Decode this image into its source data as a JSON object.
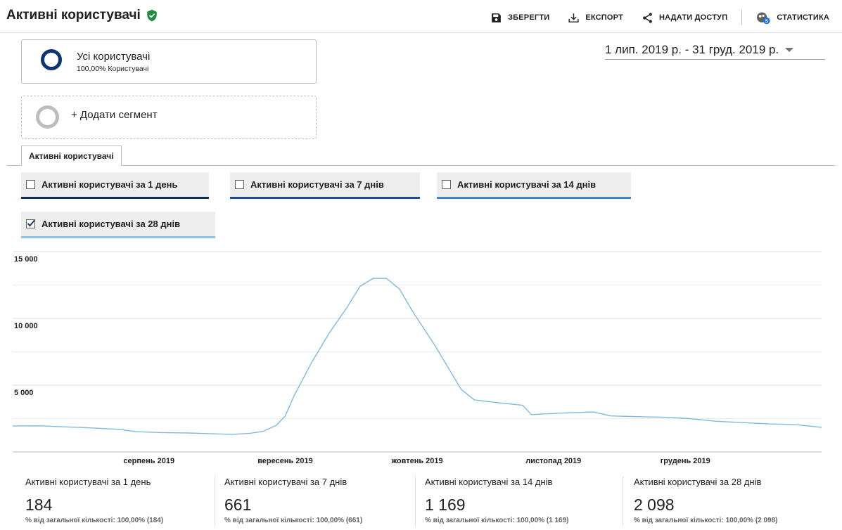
{
  "header": {
    "title": "Активні користувачі",
    "verified_icon": "shield-check-icon",
    "toolbar": [
      {
        "label": "ЗБЕРЕГТИ",
        "icon": "save-icon"
      },
      {
        "label": "ЕКСПОРТ",
        "icon": "export-icon"
      },
      {
        "label": "НАДАТИ ДОСТУП",
        "icon": "share-icon"
      },
      {
        "label": "СТАТИСТИКА",
        "icon": "insights-icon",
        "badge": "5"
      }
    ]
  },
  "segment": {
    "name": "Усі користувачі",
    "sub": "100,00% Користувачі",
    "ring_color": "#0c3372"
  },
  "add_segment": {
    "label": "+ Додати сегмент"
  },
  "date_range": {
    "label": "1 лип. 2019 р. - 31 груд. 2019 р."
  },
  "tab": {
    "label": "Активні користувачі"
  },
  "metrics": [
    {
      "label": "Активні користувачі за 1 день",
      "checked": false,
      "color": "#0c2c5c"
    },
    {
      "label": "Активні користувачі за 7 днів",
      "checked": false,
      "color": "#1a4b8c"
    },
    {
      "label": "Активні користувачі за 14 днів",
      "checked": false,
      "color": "#3d86c6"
    },
    {
      "label": "Активні користувачі за 28 днів",
      "checked": true,
      "color": "#8fc3ea"
    }
  ],
  "chart_data": {
    "type": "line",
    "yticks": [
      "15 000",
      "10 000",
      "5 000"
    ],
    "ytick_values": [
      15000,
      10000,
      5000
    ],
    "ylim": [
      0,
      15000
    ],
    "xlabels": [
      "серпень 2019",
      "вересень 2019",
      "жовтень 2019",
      "листопад 2019",
      "грудень 2019"
    ],
    "xlabel_days": [
      31,
      62,
      92,
      123,
      153
    ],
    "xdomain": [
      0,
      184
    ],
    "series": [
      {
        "color": "#7fb9e0",
        "points": [
          [
            0,
            1950
          ],
          [
            6,
            1960
          ],
          [
            12,
            1880
          ],
          [
            18,
            1800
          ],
          [
            24,
            1700
          ],
          [
            28,
            1520
          ],
          [
            34,
            1450
          ],
          [
            40,
            1420
          ],
          [
            46,
            1360
          ],
          [
            50,
            1320
          ],
          [
            54,
            1400
          ],
          [
            57,
            1550
          ],
          [
            60,
            2000
          ],
          [
            62,
            2700
          ],
          [
            64,
            4200
          ],
          [
            68,
            6700
          ],
          [
            72,
            8900
          ],
          [
            76,
            10800
          ],
          [
            79,
            12400
          ],
          [
            82,
            13000
          ],
          [
            85,
            13000
          ],
          [
            88,
            12200
          ],
          [
            91,
            10500
          ],
          [
            96,
            8000
          ],
          [
            100,
            5800
          ],
          [
            102,
            4700
          ],
          [
            105,
            3900
          ],
          [
            110,
            3700
          ],
          [
            116,
            3500
          ],
          [
            118,
            2800
          ],
          [
            124,
            2900
          ],
          [
            132,
            3000
          ],
          [
            136,
            2700
          ],
          [
            142,
            2650
          ],
          [
            148,
            2600
          ],
          [
            154,
            2500
          ],
          [
            160,
            2300
          ],
          [
            166,
            2200
          ],
          [
            172,
            2100
          ],
          [
            178,
            2050
          ],
          [
            184,
            1850
          ]
        ]
      }
    ]
  },
  "summary": [
    {
      "name": "Активні користувачі за 1 день",
      "value": "184",
      "sub": "% від загальної кількості: 100,00% (184)"
    },
    {
      "name": "Активні користувачі за 7 днів",
      "value": "661",
      "sub": "% від загальної кількості: 100,00% (661)"
    },
    {
      "name": "Активні користувачі за 14 днів",
      "value": "1 169",
      "sub": "% від загальної кількості: 100,00% (1 169)"
    },
    {
      "name": "Активні користувачі за 28 днів",
      "value": "2 098",
      "sub": "% від загальної кількості: 100,00% (2 098)"
    }
  ]
}
